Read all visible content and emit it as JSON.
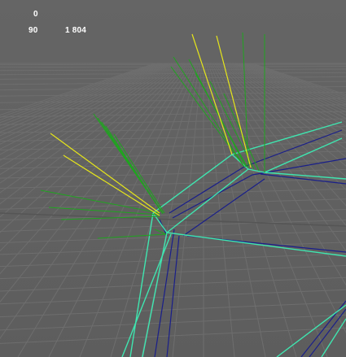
{
  "viewport": {
    "hud": {
      "line1_value": "0",
      "line2_left": "90",
      "line2_right": "1 804"
    },
    "colors": {
      "background": "#5f5f5f",
      "grid": "#6e6e6e",
      "grid_dark": "#555555",
      "wire_outer": "#3fe6b0",
      "wire_inner": "#1a1f8a",
      "normal_green": "#1fa51f",
      "normal_yellow": "#e6e61a"
    }
  }
}
